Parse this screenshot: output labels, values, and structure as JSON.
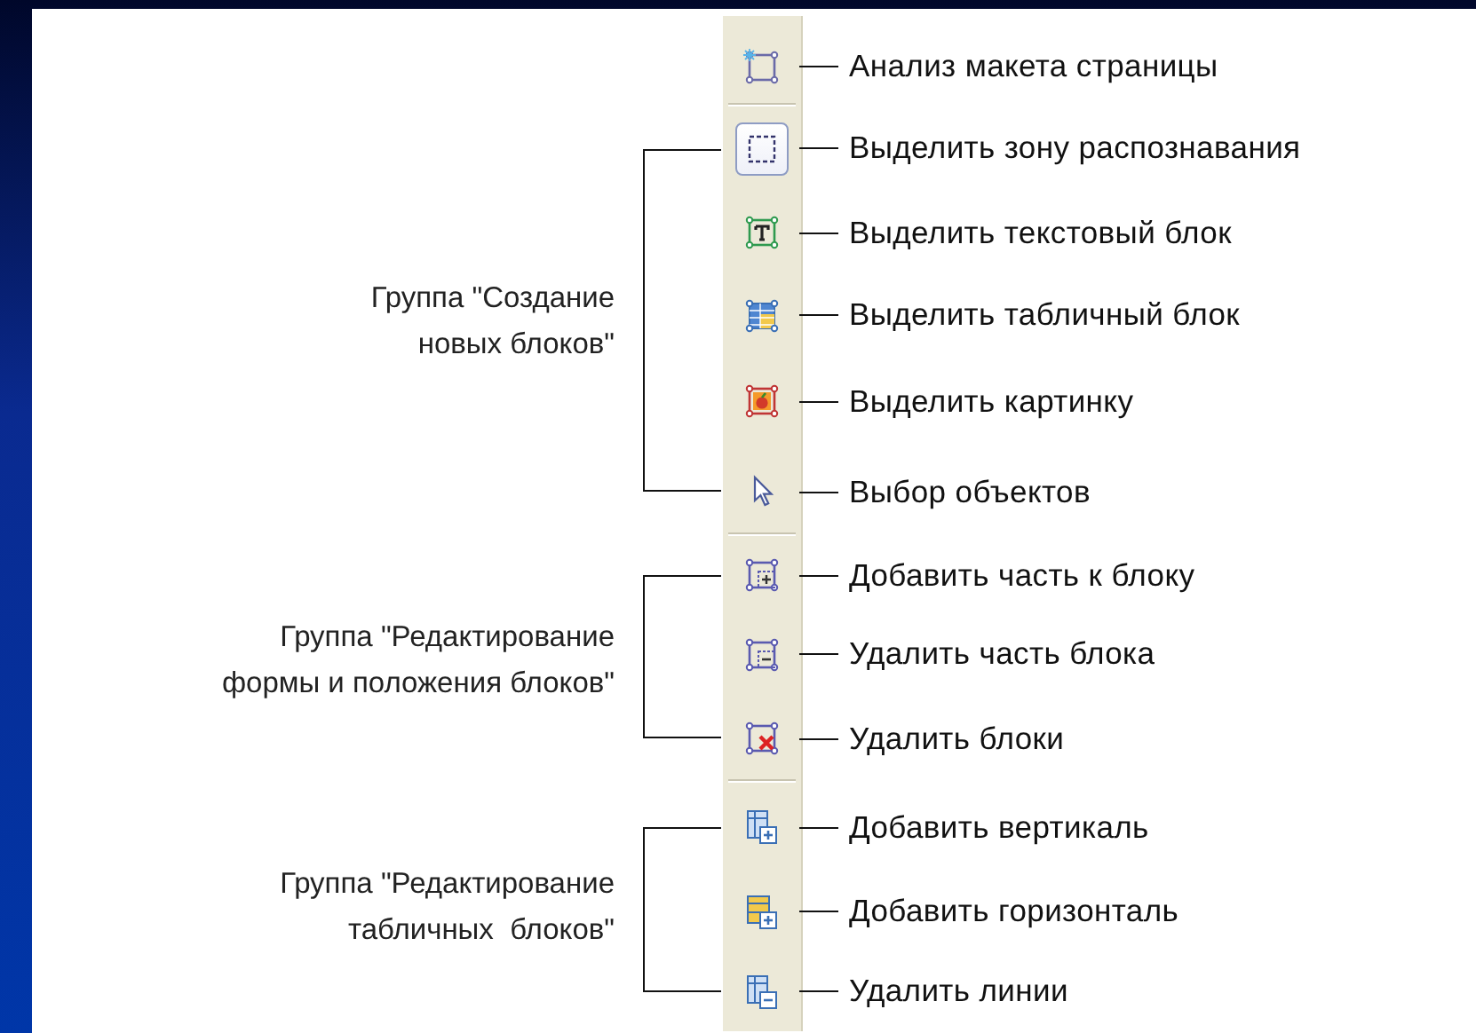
{
  "toolbar": {
    "sections": [
      {
        "tools": [
          {
            "label": "Анализ макета страницы",
            "selected": false
          }
        ]
      },
      {
        "group_label": "Группа \"Создание\nновых блоков\"",
        "tools": [
          {
            "label": "Выделить зону распознавания",
            "selected": true
          },
          {
            "label": "Выделить текстовый блок",
            "selected": false
          },
          {
            "label": "Выделить табличный блок",
            "selected": false
          },
          {
            "label": "Выделить картинку",
            "selected": false
          },
          {
            "label": "Выбор объектов",
            "selected": false
          }
        ]
      },
      {
        "group_label": "Группа \"Редактирование\nформы и положения блоков\"",
        "tools": [
          {
            "label": "Добавить часть к блоку",
            "selected": false
          },
          {
            "label": "Удалить часть блока",
            "selected": false
          },
          {
            "label": "Удалить блоки",
            "selected": false
          }
        ]
      },
      {
        "group_label": "Группа \"Редактирование\nтабличных  блоков\"",
        "tools": [
          {
            "label": "Добавить вертикаль",
            "selected": false
          },
          {
            "label": "Добавить горизонталь",
            "selected": false
          },
          {
            "label": "Удалить линии",
            "selected": false
          }
        ]
      }
    ]
  }
}
